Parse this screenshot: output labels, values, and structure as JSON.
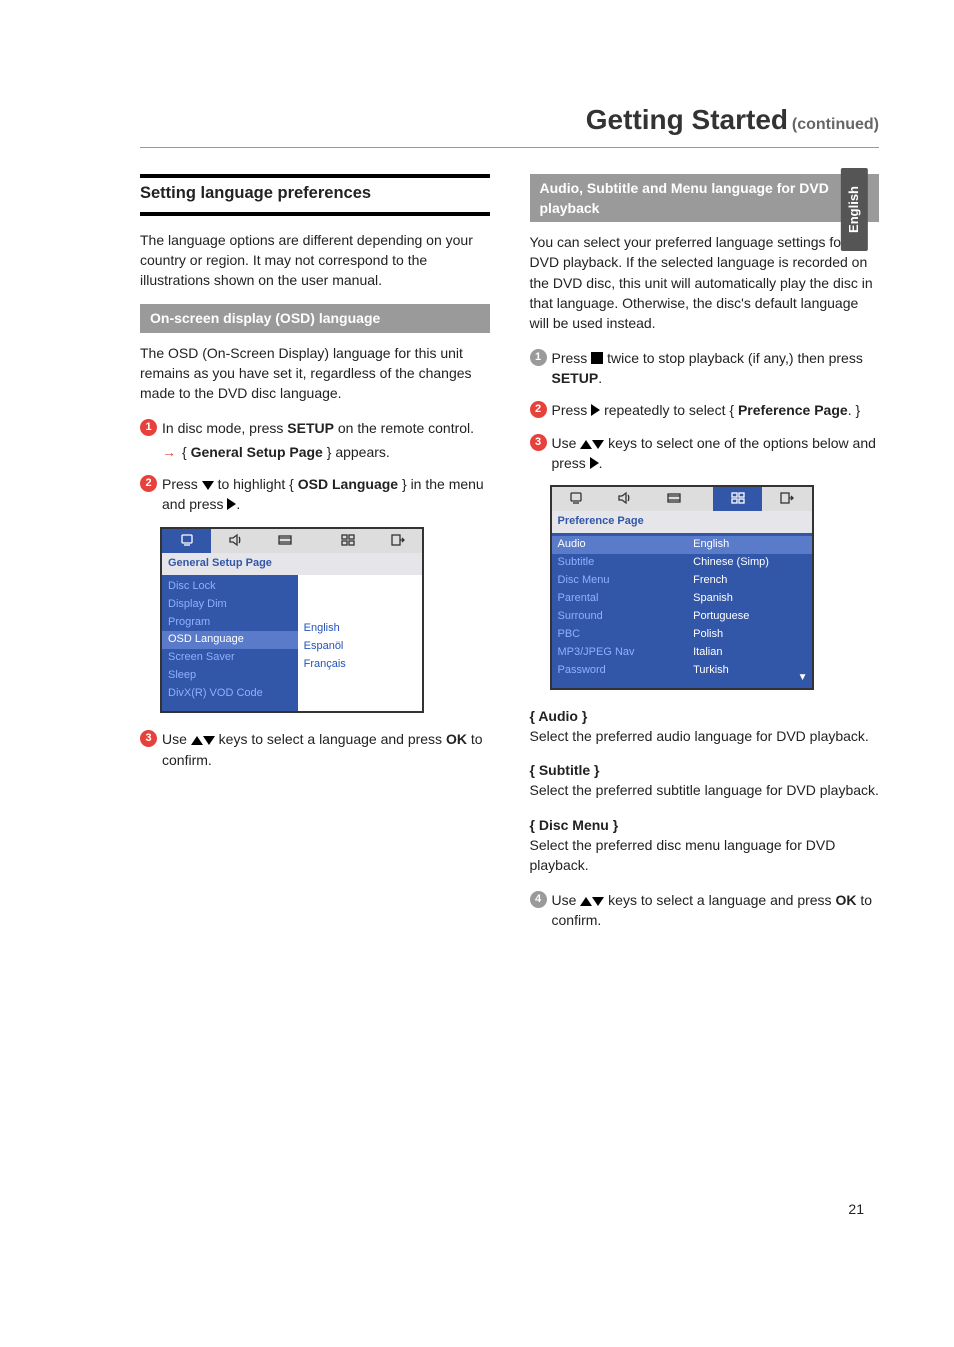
{
  "page_number": "21",
  "side_tab": "English",
  "title": {
    "main": "Getting Started",
    "cont": "(continued)"
  },
  "left": {
    "section_heading": "Setting language preferences",
    "intro": "The language options are different depending on your country or region.  It may not correspond to the illustrations shown on the user manual.",
    "sub1": "On-screen display (OSD) language",
    "osd_desc": "The OSD (On-Screen Display) language for this unit remains as you have set it, regardless of the changes made to the DVD disc language.",
    "step1_a": "In disc mode, press ",
    "step1_bold": "SETUP",
    "step1_b": " on the remote control.",
    "step1_sub_a": "{ ",
    "step1_sub_bold": "General Setup Page",
    "step1_sub_b": " } appears.",
    "step2_a": "Press ",
    "step2_b": " to highlight { ",
    "step2_bold": "OSD Language",
    "step2_c": " } in the menu and press ",
    "step2_d": ".",
    "step3_a": "Use ",
    "step3_b": " keys to select a language and press ",
    "step3_bold": "OK",
    "step3_c": " to confirm.",
    "osd1": {
      "title": "General Setup Page",
      "left_items": [
        "Disc Lock",
        "Display Dim",
        "Program",
        "OSD Language",
        "Screen Saver",
        "Sleep",
        "DivX(R) VOD Code"
      ],
      "highlight_index": 3,
      "right_items": [
        "English",
        "Espanöl",
        "Français"
      ]
    }
  },
  "right": {
    "sub1": "Audio, Subtitle and Menu language for DVD playback",
    "intro": "You can select your preferred language settings for DVD playback.  If the selected language is recorded on the DVD disc, this unit will automatically play the disc in that language.  Otherwise, the disc's default language will be used instead.",
    "step1_a": "Press  ",
    "step1_b": "  twice to stop playback (if any,) then press ",
    "step1_bold": "SETUP",
    "step1_c": ".",
    "step2_a": "Press ",
    "step2_b": " repeatedly to select    { ",
    "step2_bold": "Preference Page",
    "step2_c": ". }",
    "step3_a": "Use ",
    "step3_b": " keys to select one of the options below and press ",
    "step3_c": ".",
    "osd2": {
      "title": "Preference Page",
      "left_items": [
        "Audio",
        "Subtitle",
        "Disc Menu",
        "Parental",
        "Surround",
        "PBC",
        "MP3/JPEG Nav",
        "Password"
      ],
      "highlight_index": 0,
      "right_items": [
        "English",
        "Chinese (Simp)",
        "French",
        "Spanish",
        "Portuguese",
        "Polish",
        "Italian",
        "Turkish"
      ],
      "right_highlight_index": 0
    },
    "opt_audio_h": "{ Audio }",
    "opt_audio_t": "Select the preferred audio language for DVD playback.",
    "opt_sub_h": "{ Subtitle }",
    "opt_sub_t": "Select the preferred subtitle language for DVD playback.",
    "opt_disc_h": "{ Disc Menu }",
    "opt_disc_t": "Select the preferred disc menu language for DVD playback.",
    "step4_a": "Use ",
    "step4_b": " keys to select a language and press ",
    "step4_bold": "OK",
    "step4_c": " to confirm."
  }
}
